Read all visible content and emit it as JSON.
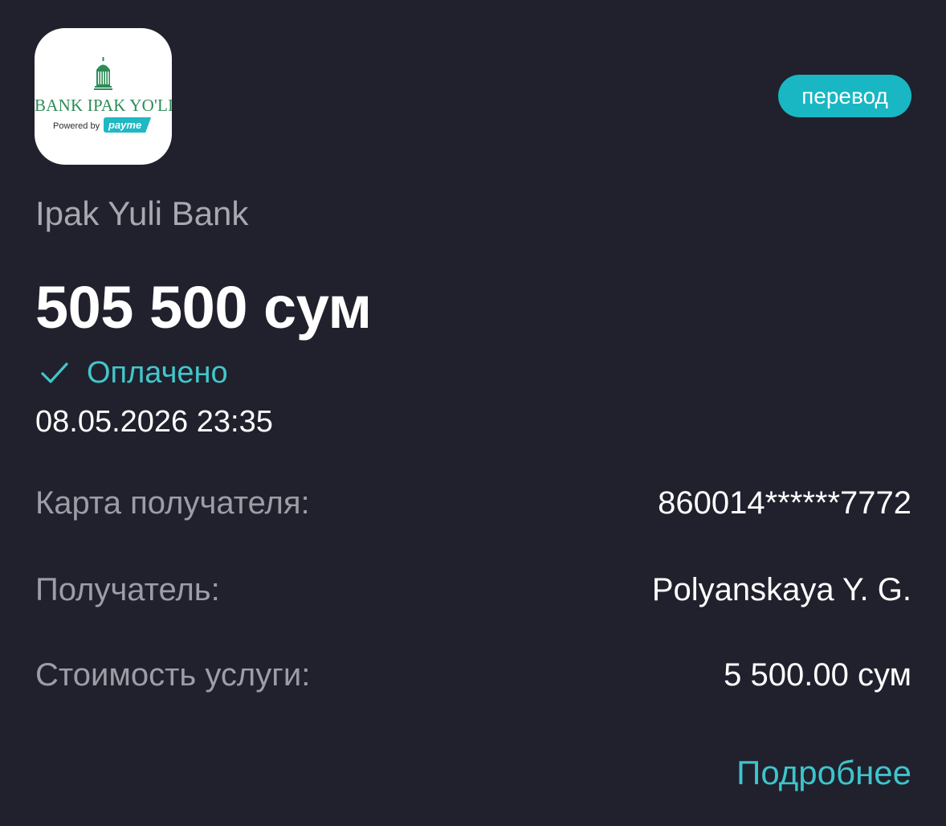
{
  "logo": {
    "bank_name": "BANK IPAK YO'LI",
    "powered_by": "Powered by",
    "payme": "payme"
  },
  "badge": {
    "label": "перевод"
  },
  "bank_title": "Ipak Yuli Bank",
  "amount": "505 500 сум",
  "status": {
    "label": "Оплачено",
    "icon": "checkmark-icon"
  },
  "datetime": "08.05.2026 23:35",
  "details": [
    {
      "label": "Карта получателя:",
      "value": "860014******7772"
    },
    {
      "label": "Получатель:",
      "value": "Polyanskaya Y. G."
    },
    {
      "label": "Стоимость услуги:",
      "value": "5 500.00 сум"
    }
  ],
  "more_link": "Подробнее",
  "colors": {
    "background": "#20212c",
    "accent": "#18b7c3",
    "status": "#43c6cc",
    "logo_green": "#2e8b57"
  }
}
